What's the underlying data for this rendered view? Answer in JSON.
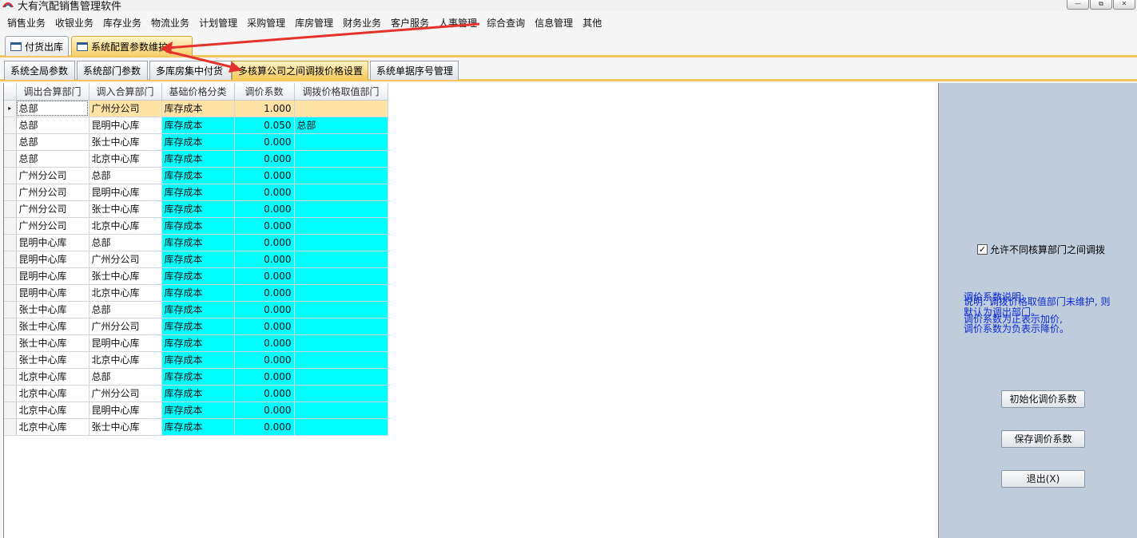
{
  "window": {
    "title": "大有汽配销售管理软件",
    "buttons": [
      "—",
      "⧉",
      "✕"
    ]
  },
  "menu": [
    "销售业务",
    "收银业务",
    "库存业务",
    "物流业务",
    "计划管理",
    "采购管理",
    "库房管理",
    "财务业务",
    "客户服务",
    "人事管理",
    "综合查询",
    "信息管理",
    "其他"
  ],
  "doc_tabs": [
    {
      "label": "付货出库",
      "active": false
    },
    {
      "label": "系统配置参数维护",
      "active": true
    }
  ],
  "sub_tabs": [
    {
      "label": "系统全局参数",
      "active": false
    },
    {
      "label": "系统部门参数",
      "active": false
    },
    {
      "label": "多库房集中付货",
      "active": false
    },
    {
      "label": "多核算公司之间调拨价格设置",
      "active": true
    },
    {
      "label": "系统单据序号管理",
      "active": false
    }
  ],
  "grid": {
    "columns": [
      "调出合算部门",
      "调入合算部门",
      "基础价格分类",
      "调价系数",
      "调拨价格取值部门"
    ],
    "rows": [
      [
        "总部",
        "广州分公司",
        "库存成本",
        "1.000",
        ""
      ],
      [
        "总部",
        "昆明中心库",
        "库存成本",
        "0.050",
        "总部"
      ],
      [
        "总部",
        "张士中心库",
        "库存成本",
        "0.000",
        ""
      ],
      [
        "总部",
        "北京中心库",
        "库存成本",
        "0.000",
        ""
      ],
      [
        "广州分公司",
        "总部",
        "库存成本",
        "0.000",
        ""
      ],
      [
        "广州分公司",
        "昆明中心库",
        "库存成本",
        "0.000",
        ""
      ],
      [
        "广州分公司",
        "张士中心库",
        "库存成本",
        "0.000",
        ""
      ],
      [
        "广州分公司",
        "北京中心库",
        "库存成本",
        "0.000",
        ""
      ],
      [
        "昆明中心库",
        "总部",
        "库存成本",
        "0.000",
        ""
      ],
      [
        "昆明中心库",
        "广州分公司",
        "库存成本",
        "0.000",
        ""
      ],
      [
        "昆明中心库",
        "张士中心库",
        "库存成本",
        "0.000",
        ""
      ],
      [
        "昆明中心库",
        "北京中心库",
        "库存成本",
        "0.000",
        ""
      ],
      [
        "张士中心库",
        "总部",
        "库存成本",
        "0.000",
        ""
      ],
      [
        "张士中心库",
        "广州分公司",
        "库存成本",
        "0.000",
        ""
      ],
      [
        "张士中心库",
        "昆明中心库",
        "库存成本",
        "0.000",
        ""
      ],
      [
        "张士中心库",
        "北京中心库",
        "库存成本",
        "0.000",
        ""
      ],
      [
        "北京中心库",
        "总部",
        "库存成本",
        "0.000",
        ""
      ],
      [
        "北京中心库",
        "广州分公司",
        "库存成本",
        "0.000",
        ""
      ],
      [
        "北京中心库",
        "昆明中心库",
        "库存成本",
        "0.000",
        ""
      ],
      [
        "北京中心库",
        "张士中心库",
        "库存成本",
        "0.000",
        ""
      ]
    ],
    "selected_row": 0,
    "row_indicator": "▸"
  },
  "panel": {
    "checkbox_label": "允许不同核算部门之间调拨",
    "checkbox_checked": true,
    "check_mark": "✓",
    "notes": [
      "调价系数说明:",
      "说明: 调拨价格取值部门未维护, 则",
      "默认为调出部门。",
      "调价系数为正表示加价,",
      "调价系数为负表示降价。"
    ],
    "buttons": {
      "init": "初始化调价系数",
      "save": "保存调价系数",
      "exit": "退出(X)"
    }
  },
  "colors": {
    "accent_yellow": "#f3c75e",
    "grid_cyan": "#00ffff",
    "selected_row": "#ffe2a6",
    "panel_bg": "#bfccdc",
    "note_blue": "#0a2bd6",
    "annotation_red": "#e5322d"
  }
}
